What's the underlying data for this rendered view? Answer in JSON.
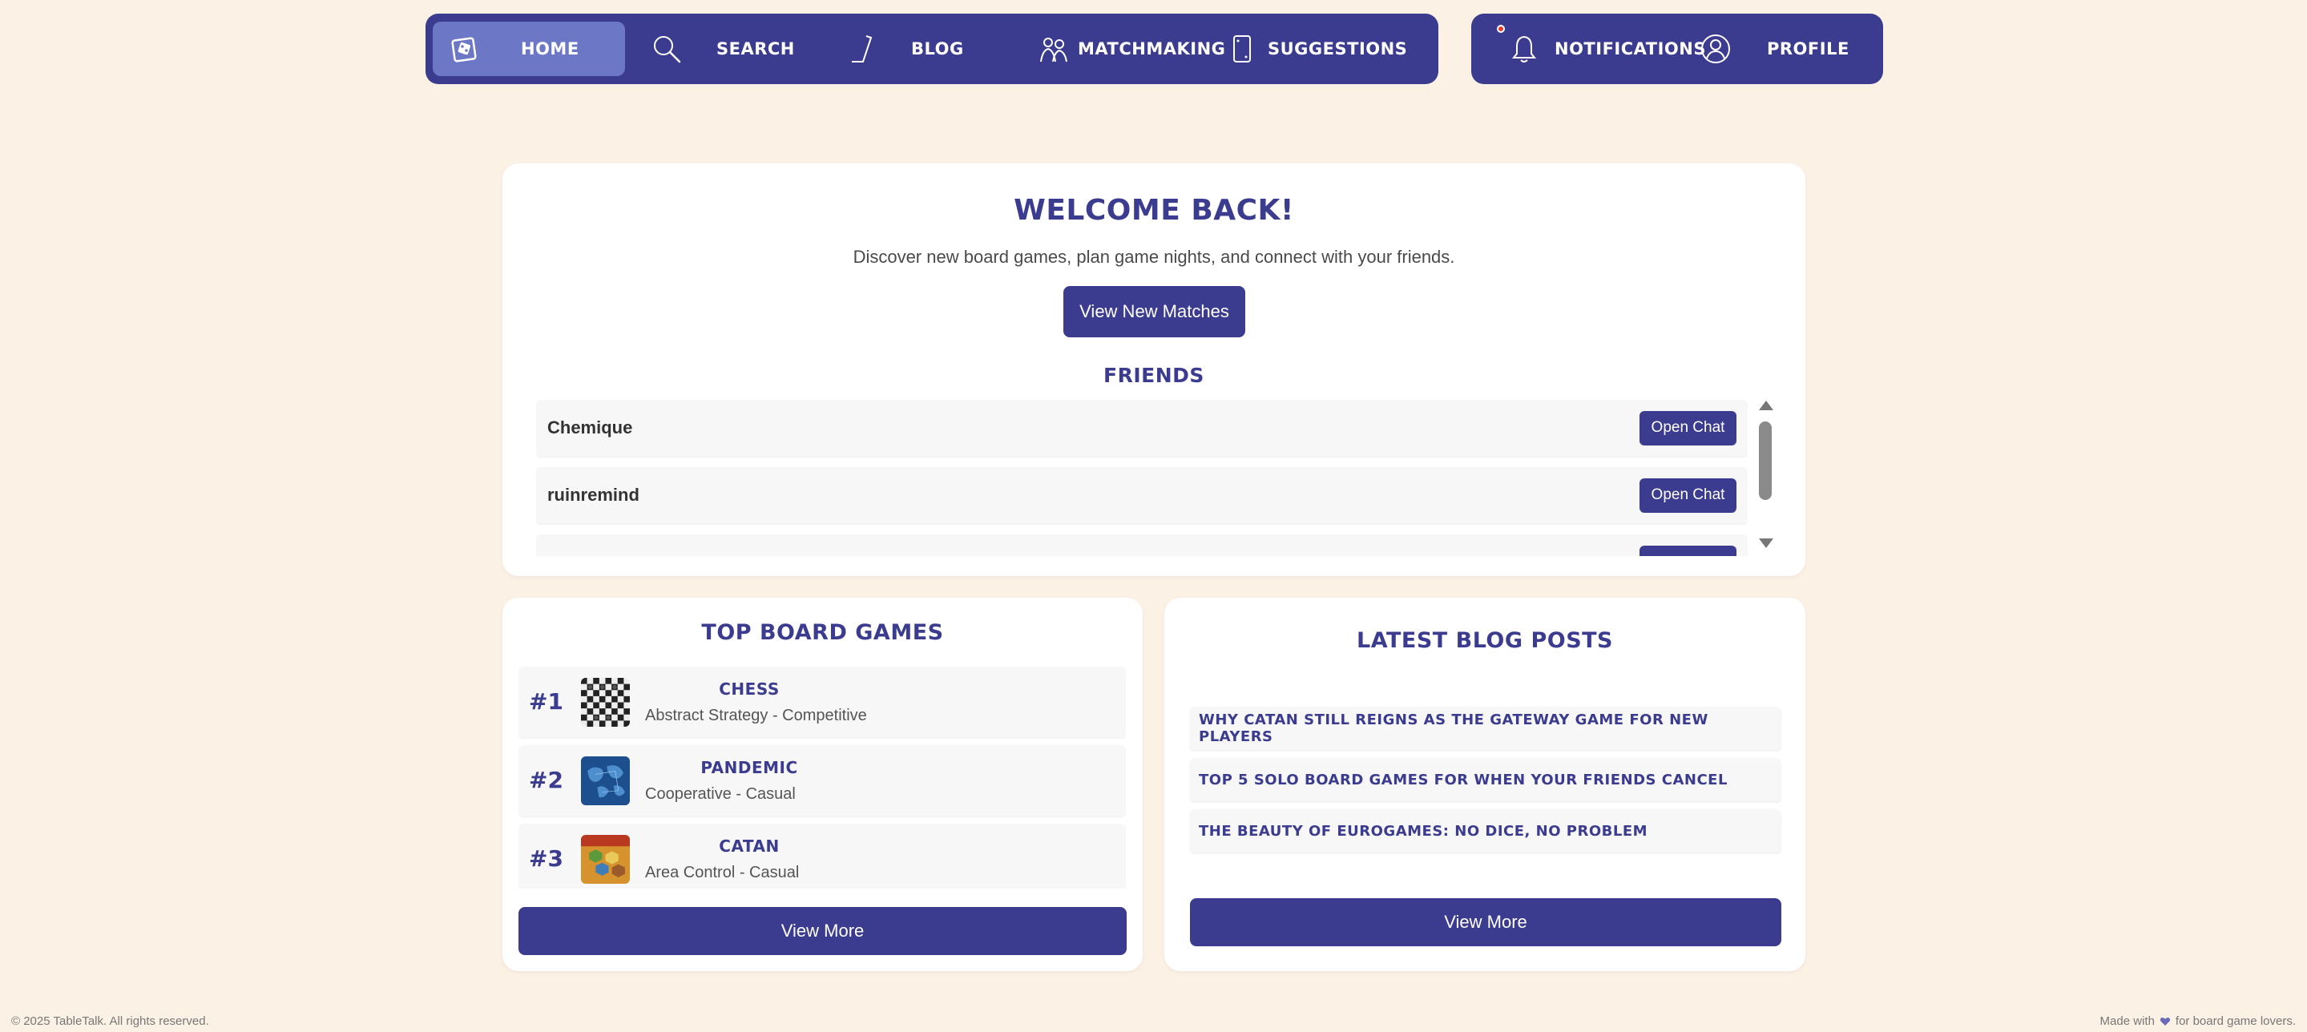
{
  "nav": {
    "items": [
      {
        "label": "Home",
        "icon": "board-game-icon",
        "active": true
      },
      {
        "label": "Search",
        "icon": "search-icon"
      },
      {
        "label": "Blog",
        "icon": "pen-icon"
      },
      {
        "label": "Matchmaking",
        "icon": "people-icon"
      },
      {
        "label": "Suggestions",
        "icon": "card-icon"
      }
    ],
    "right": [
      {
        "label": "Notifications",
        "icon": "bell-icon",
        "has_unread": true
      },
      {
        "label": "Profile",
        "icon": "user-icon"
      }
    ],
    "colors": {
      "bar": "#3b3b8f",
      "active": "#6c77c5",
      "badge": "#e43b2f"
    }
  },
  "welcome": {
    "title": "Welcome Back!",
    "subtitle": "Discover new board games, plan game nights, and connect with your friends.",
    "cta": "View New Matches"
  },
  "friends": {
    "title": "Friends",
    "items": [
      {
        "name": "Chemique",
        "action": "Open Chat"
      },
      {
        "name": "ruinremind",
        "action": "Open Chat"
      },
      {
        "name": "",
        "action": ""
      }
    ]
  },
  "games": {
    "title": "Top Board Games",
    "items": [
      {
        "rank": "#1",
        "name": "Chess",
        "meta": "Abstract Strategy - Competitive",
        "thumb": "chess-board-image"
      },
      {
        "rank": "#2",
        "name": "Pandemic",
        "meta": "Cooperative - Casual",
        "thumb": "world-map-image"
      },
      {
        "rank": "#3",
        "name": "Catan",
        "meta": "Area Control - Casual",
        "thumb": "catan-box-image"
      }
    ],
    "more": "View More"
  },
  "blog": {
    "title": "Latest Blog Posts",
    "items": [
      "Why Catan Still Reigns as the Gateway Game for New Players",
      "Top 5 Solo Board Games for When Your Friends Cancel",
      "The Beauty of Eurogames: No Dice, No Problem"
    ],
    "more": "View More"
  },
  "footer": {
    "copyright": "© 2025 TableTalk. All rights reserved.",
    "made_prefix": "Made with",
    "made_suffix": "for board game lovers."
  },
  "theme": {
    "page_bg": "#fcf1e5",
    "accent": "#3b3b8f"
  }
}
